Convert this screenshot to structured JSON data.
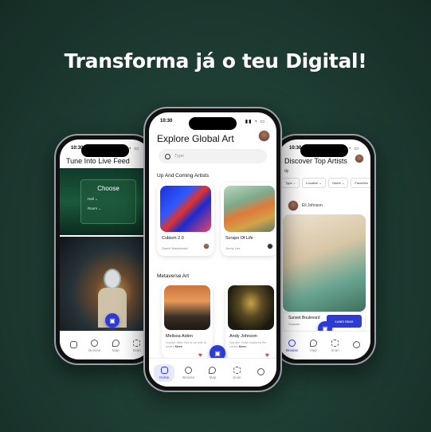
{
  "headline": "Transforma já o teu Digital!",
  "colors": {
    "accent": "#2e3bd1",
    "background": "#1f3f35",
    "heart": "#e53935"
  },
  "left_phone": {
    "time": "10:30",
    "title": "Tune Into Live Feed",
    "choose": {
      "title": "Choose",
      "rows": [
        "Hall",
        "Room"
      ]
    },
    "nav": [
      "",
      "Browse",
      "Map",
      "Scan"
    ]
  },
  "center_phone": {
    "time": "10:30",
    "title": "Explore Global Art",
    "search_placeholder": "Type",
    "section1": "Up And Coming Artists",
    "cards": [
      {
        "title": "Cubism 2.0",
        "artist": "Daniel Wasdewski"
      },
      {
        "title": "Scraps Of Life",
        "artist": "Jenny Lee"
      }
    ],
    "section2": "Metaverse Art",
    "cards2": [
      {
        "artist": "Melissa Aiden",
        "desc": "Sunset With You is an ode to lovers",
        "more": "More"
      },
      {
        "artist": "Andy Johnson",
        "desc": "Garden Glow explores the colors",
        "more": "More"
      }
    ],
    "nav": [
      "Home",
      "Browse",
      "Map",
      "Scan",
      ""
    ]
  },
  "right_phone": {
    "time": "10:30",
    "title": "Discover Top Artists",
    "subtitle": "dy",
    "filters": [
      "Type",
      "Location",
      "Genre",
      "Favorites"
    ],
    "post_user": "Eli Johnson",
    "artwork_title": "Sunset Boulevard",
    "artwork_sub": "Seaside",
    "learn_more": "Learn More",
    "nav": [
      "Browse",
      "Map",
      "Scan",
      ""
    ]
  }
}
